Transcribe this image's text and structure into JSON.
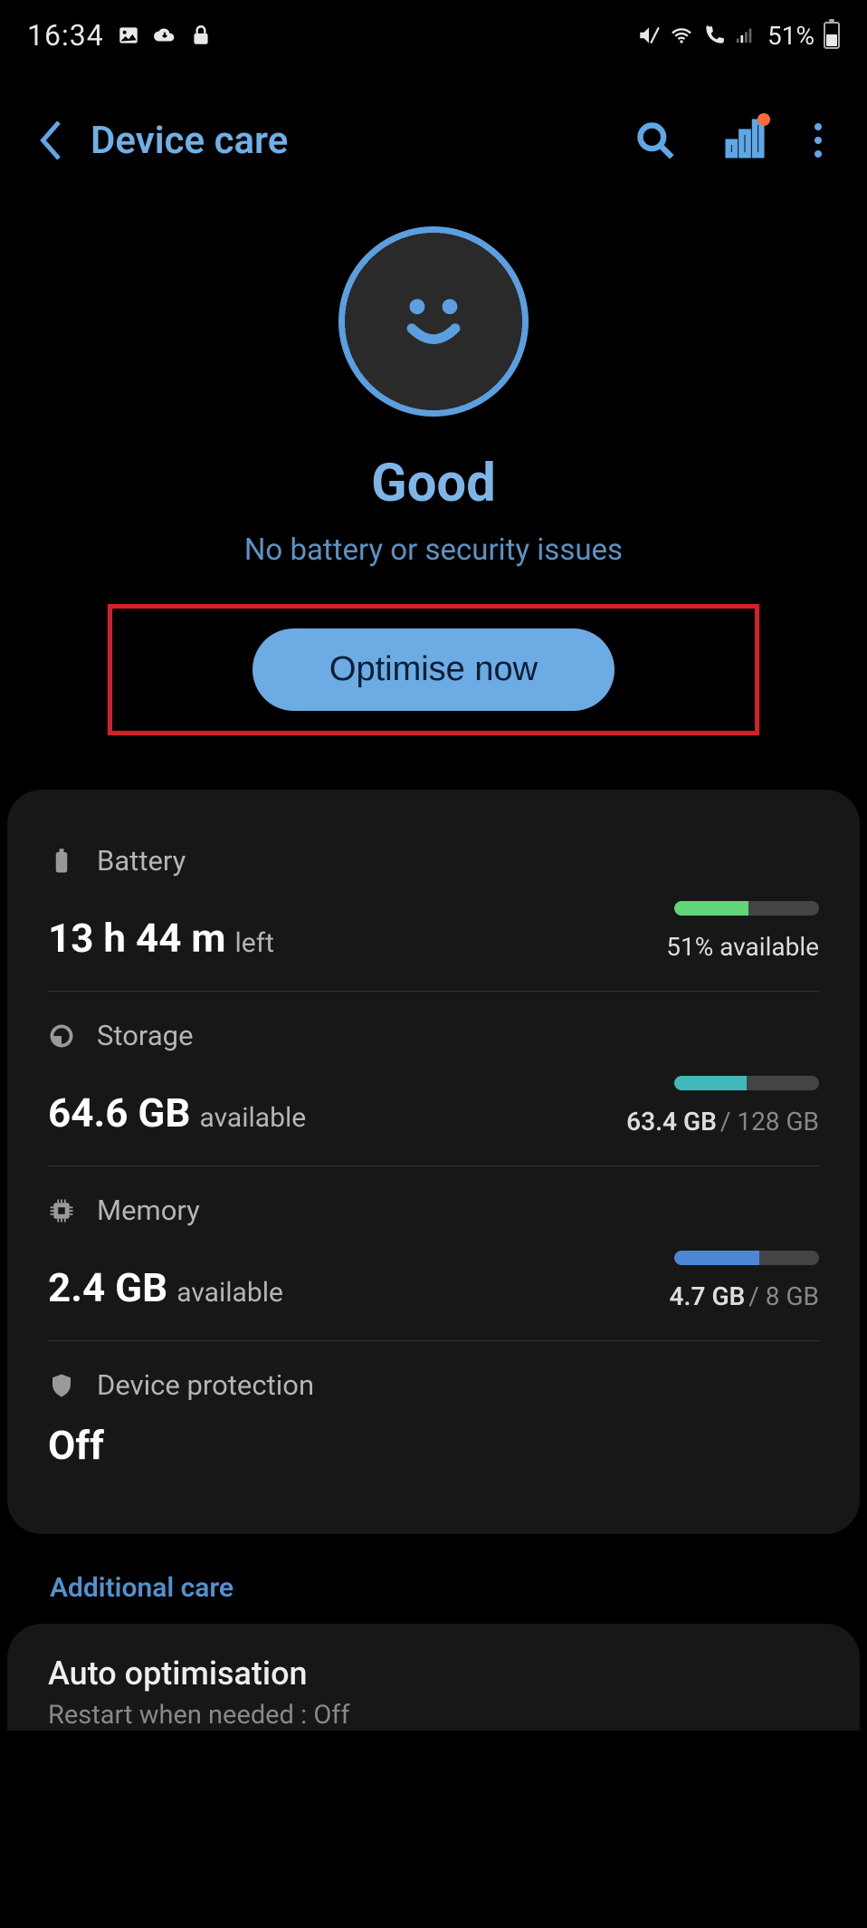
{
  "status_bar": {
    "time": "16:34",
    "battery_pct": "51%"
  },
  "header": {
    "title": "Device care"
  },
  "hero": {
    "status": "Good",
    "subtitle": "No battery or security issues",
    "button": "Optimise now"
  },
  "battery": {
    "label": "Battery",
    "value": "13 h 44 m",
    "suffix": "left",
    "right_text": "51% available",
    "fill_pct": 51,
    "fill_color": "#62d779"
  },
  "storage": {
    "label": "Storage",
    "value": "64.6 GB",
    "suffix": "available",
    "used": "63.4 GB",
    "total": "128 GB",
    "fill_pct": 50,
    "fill_color": "#3fb9b9"
  },
  "memory": {
    "label": "Memory",
    "value": "2.4 GB",
    "suffix": "available",
    "used": "4.7 GB",
    "total": "8 GB",
    "fill_pct": 59,
    "fill_color": "#4b87d6"
  },
  "protection": {
    "label": "Device protection",
    "value": "Off"
  },
  "additional": {
    "section": "Additional care",
    "auto_title": "Auto optimisation",
    "auto_sub": "Restart when needed : Off"
  }
}
